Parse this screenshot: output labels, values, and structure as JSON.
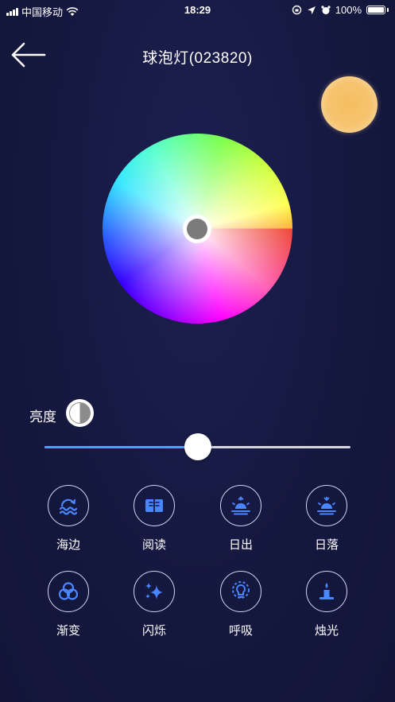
{
  "status_bar": {
    "carrier": "中国移动",
    "time": "18:29",
    "battery": "100%"
  },
  "header": {
    "title": "球泡灯(023820)"
  },
  "color": {
    "preview_color": "#f6c46c",
    "picker_color": "#7b7b7b"
  },
  "brightness": {
    "label": "亮度",
    "level_percent": 50
  },
  "modes": [
    {
      "label": "海边",
      "icon": "wave-icon"
    },
    {
      "label": "阅读",
      "icon": "book-icon"
    },
    {
      "label": "日出",
      "icon": "sunrise-icon"
    },
    {
      "label": "日落",
      "icon": "sunset-icon"
    },
    {
      "label": "渐变",
      "icon": "gradient-icon"
    },
    {
      "label": "闪烁",
      "icon": "sparkle-icon"
    },
    {
      "label": "呼吸",
      "icon": "bulb-icon"
    },
    {
      "label": "烛光",
      "icon": "candle-icon"
    }
  ],
  "colors": {
    "accent": "#3fa8f5",
    "icon_blue": "#4a86ff",
    "background": "#15183f"
  }
}
